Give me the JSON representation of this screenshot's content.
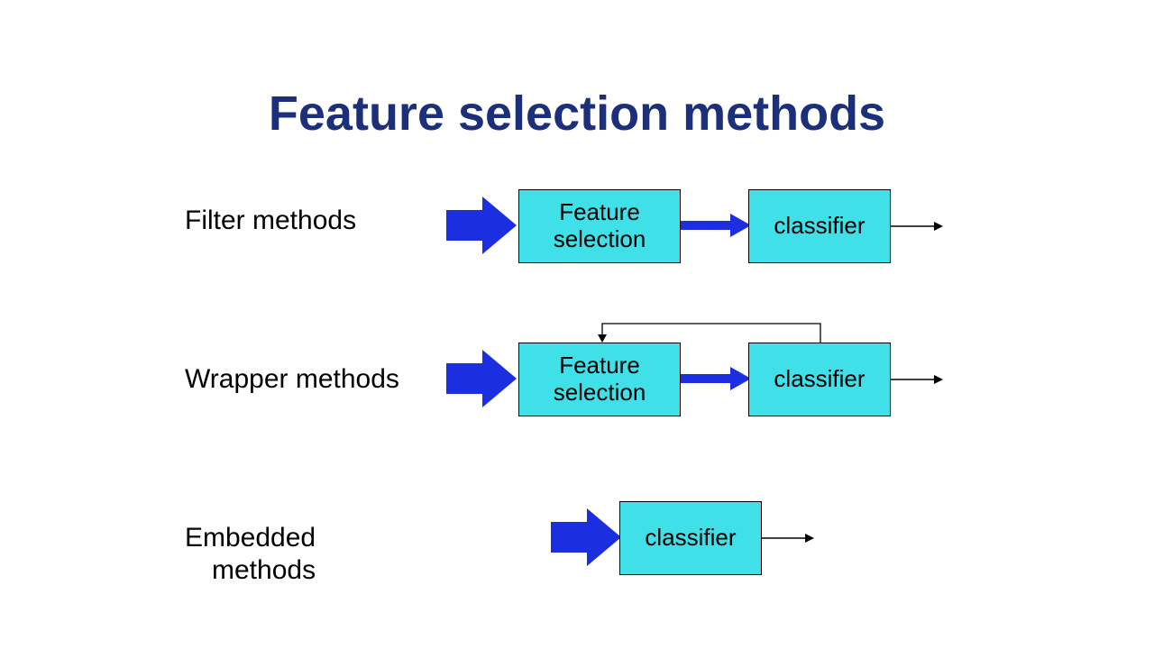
{
  "title": "Feature selection methods",
  "rows": {
    "filter": {
      "label": "Filter methods",
      "box1": "Feature\nselection",
      "box2": "classifier"
    },
    "wrapper": {
      "label": "Wrapper methods",
      "box1": "Feature\nselection",
      "box2": "classifier"
    },
    "embedded": {
      "label_line1": "Embedded",
      "label_line2": "methods",
      "box1": "classifier"
    }
  },
  "colors": {
    "title": "#1b2f7a",
    "box_fill": "#3fe0e8",
    "big_arrow": "#1b2fe0",
    "thin_arrow": "#000000"
  }
}
